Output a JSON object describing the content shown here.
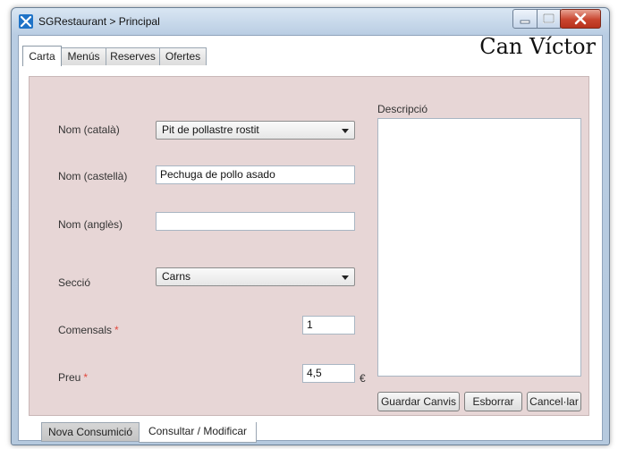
{
  "window": {
    "title": "SGRestaurant > Principal"
  },
  "brand": "Can Víctor",
  "tabs": [
    {
      "label": "Carta",
      "active": true
    },
    {
      "label": "Menús",
      "active": false
    },
    {
      "label": "Reserves",
      "active": false
    },
    {
      "label": "Ofertes",
      "active": false
    }
  ],
  "form": {
    "nom_catala": {
      "label": "Nom (català)",
      "value": "Pit de pollastre rostit"
    },
    "nom_castella": {
      "label": "Nom (castellà)",
      "value": "Pechuga de pollo asado"
    },
    "nom_angles": {
      "label": "Nom (anglès)",
      "value": ""
    },
    "seccio": {
      "label": "Secció",
      "value": "Carns"
    },
    "comensals": {
      "label": "Comensals",
      "required_mark": "*",
      "value": "1"
    },
    "preu": {
      "label": "Preu",
      "required_mark": "*",
      "value": "4,5",
      "unit": "€"
    }
  },
  "descripcio": {
    "label": "Descripció",
    "value": ""
  },
  "buttons": {
    "save": "Guardar Canvis",
    "delete": "Esborrar",
    "cancel": "Cancel·lar"
  },
  "bottom_tabs": [
    {
      "label": "Nova Consumició",
      "active": false
    },
    {
      "label": "Consultar / Modificar",
      "active": true
    }
  ],
  "colors": {
    "panel": "#e7d6d6",
    "required": "#e2483d",
    "close_button": "#c9452f"
  }
}
